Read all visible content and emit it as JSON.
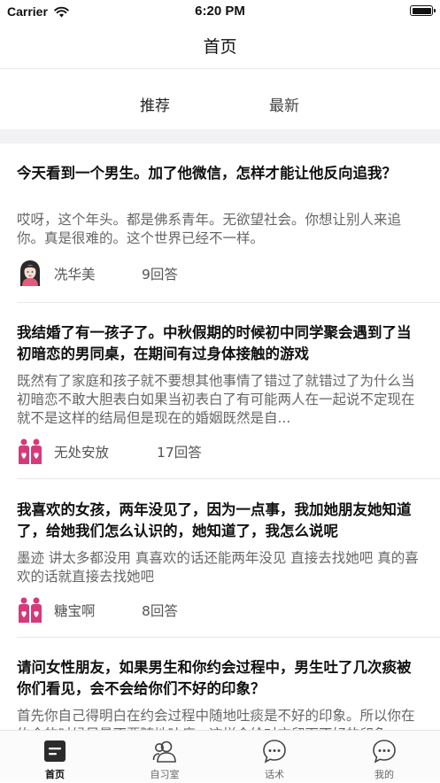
{
  "status_bar": {
    "carrier": "Carrier",
    "time": "6:20 PM",
    "battery_level": 1.0
  },
  "nav": {
    "title": "首页"
  },
  "tabs": [
    {
      "label": "推荐"
    },
    {
      "label": "最新"
    }
  ],
  "posts": [
    {
      "title": "今天看到一个男生。加了他微信，怎样才能让他反向追我？",
      "excerpt": "哎呀，这个年头。都是佛系青年。无欲望社会。你想让别人来追你。真是很难的。这个世界已经不一样。",
      "author": "冼华美",
      "answers": "9回答",
      "avatar": "woman-avatar-icon"
    },
    {
      "title": "我结婚了有一孩子了。中秋假期的时候初中同学聚会遇到了当初暗恋的男同桌，在期间有过身体接触的游戏",
      "excerpt": "既然有了家庭和孩子就不要想其他事情了错过了就错过了为什么当初暗恋不敢大胆表白如果当初表白了有可能两人在一起说不定现在就不是这样的结局但是现在的婚姻既然是自...",
      "author": "无处安放",
      "answers": "17回答",
      "avatar": "couple-icon"
    },
    {
      "title": "我喜欢的女孩，两年没见了，因为一点事，我加她朋友她知道了，给她我们怎么认识的，她知道了，我怎么说呢",
      "excerpt": "墨迹 讲太多都没用 真喜欢的话还能两年没见 直接去找她吧 真的喜欢的话就直接去找她吧",
      "author": "糖宝啊",
      "answers": "8回答",
      "avatar": "couple-icon"
    },
    {
      "title": "请问女性朋友，如果男生和你约会过程中，男生吐了几次痰被你们看见，会不会给你们不好的印象？",
      "excerpt": "首先你自己得明白在约会过程中随地吐痰是不好的印象。所以你在约会的时候尽量不要随地吐痰，这样会给对方留下不好的印象。",
      "author": "",
      "answers": "",
      "avatar": ""
    }
  ],
  "tab_bar": [
    {
      "label": "首页",
      "icon": "home-doc-icon",
      "active": true
    },
    {
      "label": "自习室",
      "icon": "people-icon",
      "active": false
    },
    {
      "label": "话术",
      "icon": "chat-bubble-icon",
      "active": false
    },
    {
      "label": "我的",
      "icon": "chat-bubble-icon",
      "active": false
    }
  ],
  "colors": {
    "accent_pink": "#d63a7a",
    "text_primary": "#111111",
    "text_secondary": "#666666",
    "separator": "#f2f2f4"
  }
}
